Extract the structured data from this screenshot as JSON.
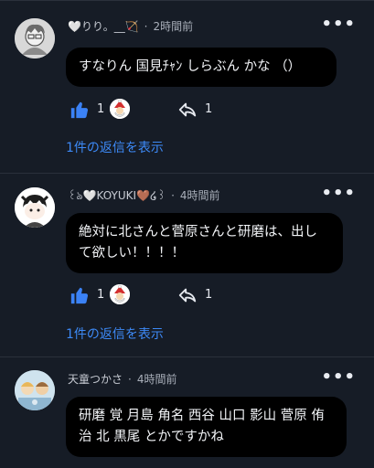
{
  "comments": [
    {
      "user": "🤍りり。__🏹",
      "time": "2時間前",
      "text": "すなりん 国見ﾁｬﾝ しらぶん かな （）",
      "likes": "1",
      "replies_count": "1",
      "replies_link": "1件の返信を表示"
    },
    {
      "user": "꒰ঌ🤍KOYUKI🤎໒꒱",
      "time": "4時間前",
      "text": "絶対に北さんと菅原さんと研磨は、出して欲しい！！！！",
      "likes": "1",
      "replies_count": "1",
      "replies_link": "1件の返信を表示"
    },
    {
      "user": "天童つかさ",
      "time": "4時間前",
      "text": "研磨 覚 月島 角名 西谷 山口 影山 菅原 侑 治 北 黒尾 とかですかね"
    }
  ],
  "ui": {
    "separator": "·",
    "more_icon": "•••"
  },
  "colors": {
    "background": "#161c26",
    "bubble": "#000000",
    "link": "#3d8af7",
    "like": "#3b82f6"
  }
}
